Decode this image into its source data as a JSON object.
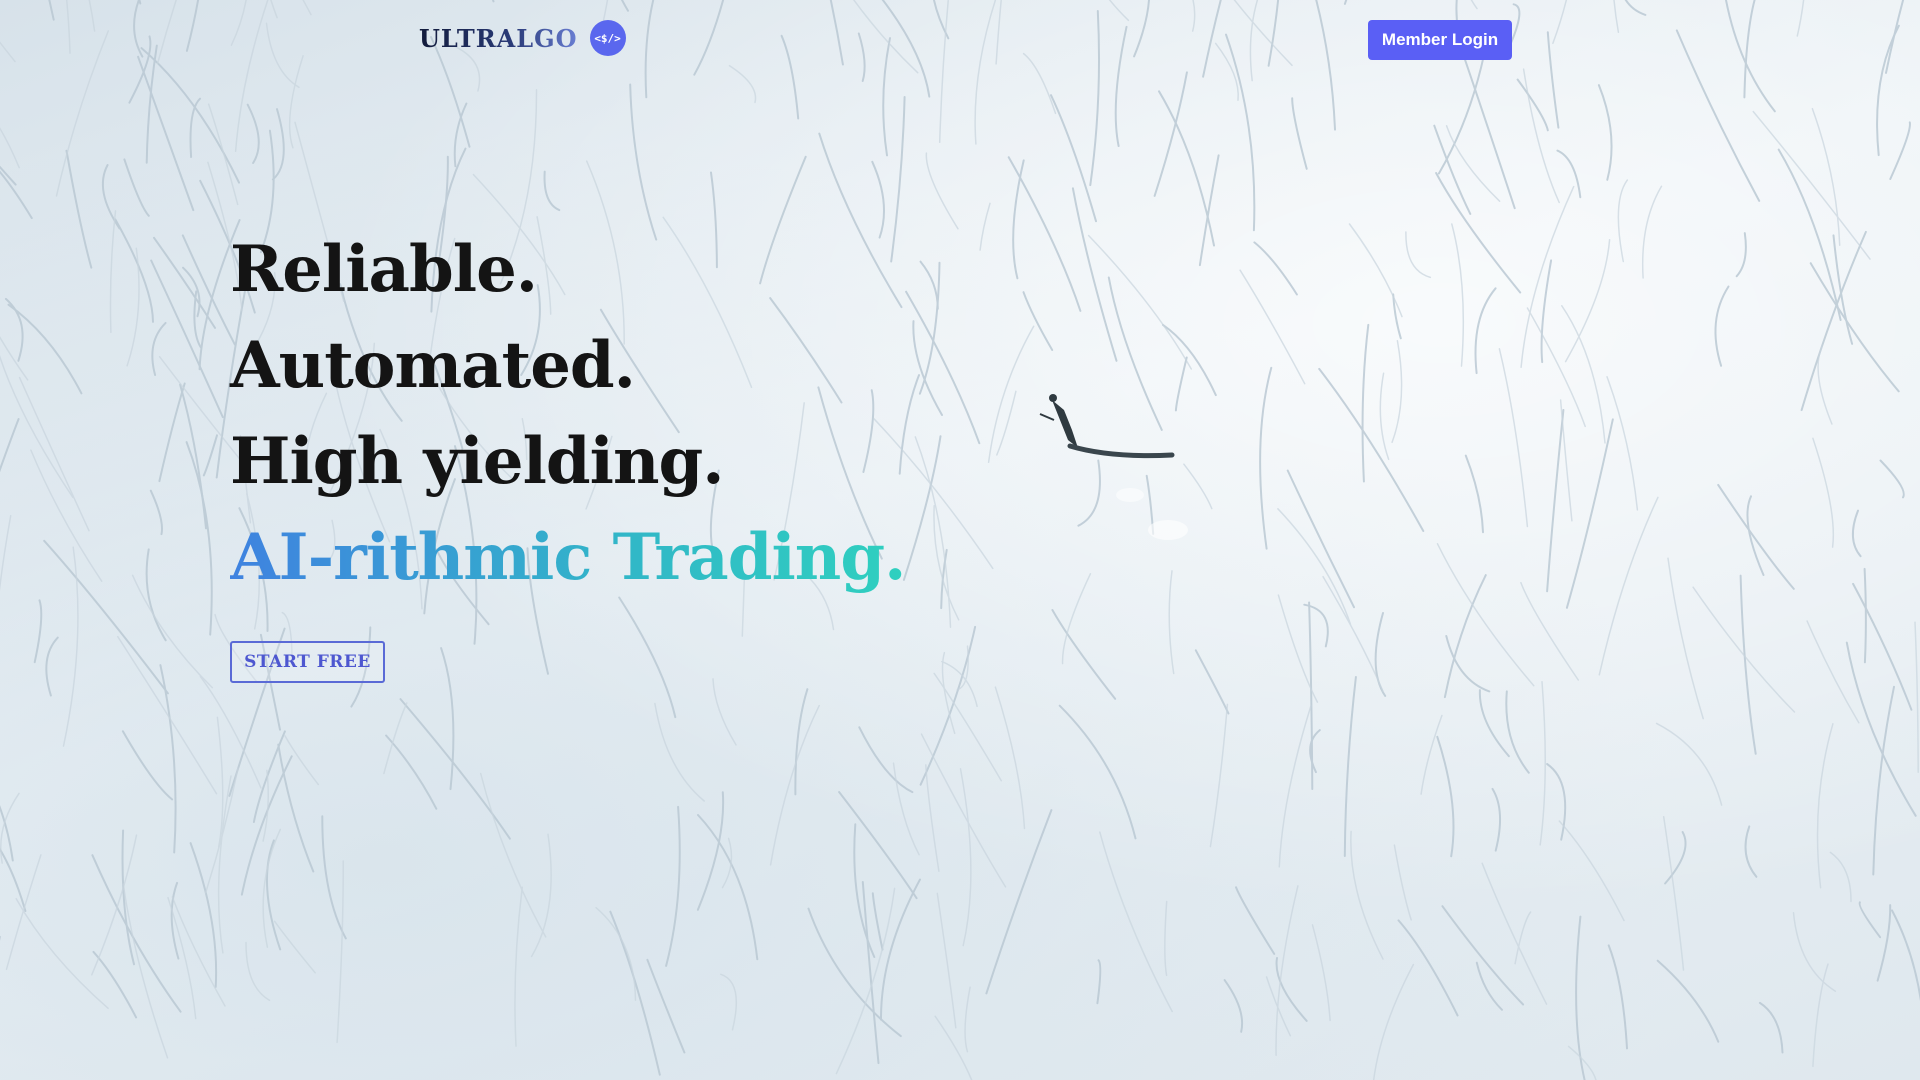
{
  "header": {
    "logo_text": "ULTRALGO",
    "logo_badge": "<$/>",
    "login_label": "Member Login"
  },
  "hero": {
    "lines": [
      "Reliable.",
      "Automated.",
      "High yielding."
    ],
    "accent_line": "AI-rithmic Trading.",
    "cta_label": "START FREE",
    "background": "aerial-snow-slope-with-skier"
  },
  "colors": {
    "brand": "#5a5ff5",
    "heading": "#141414",
    "gradient_start": "#3f82e0",
    "gradient_end": "#2fd0bf"
  }
}
